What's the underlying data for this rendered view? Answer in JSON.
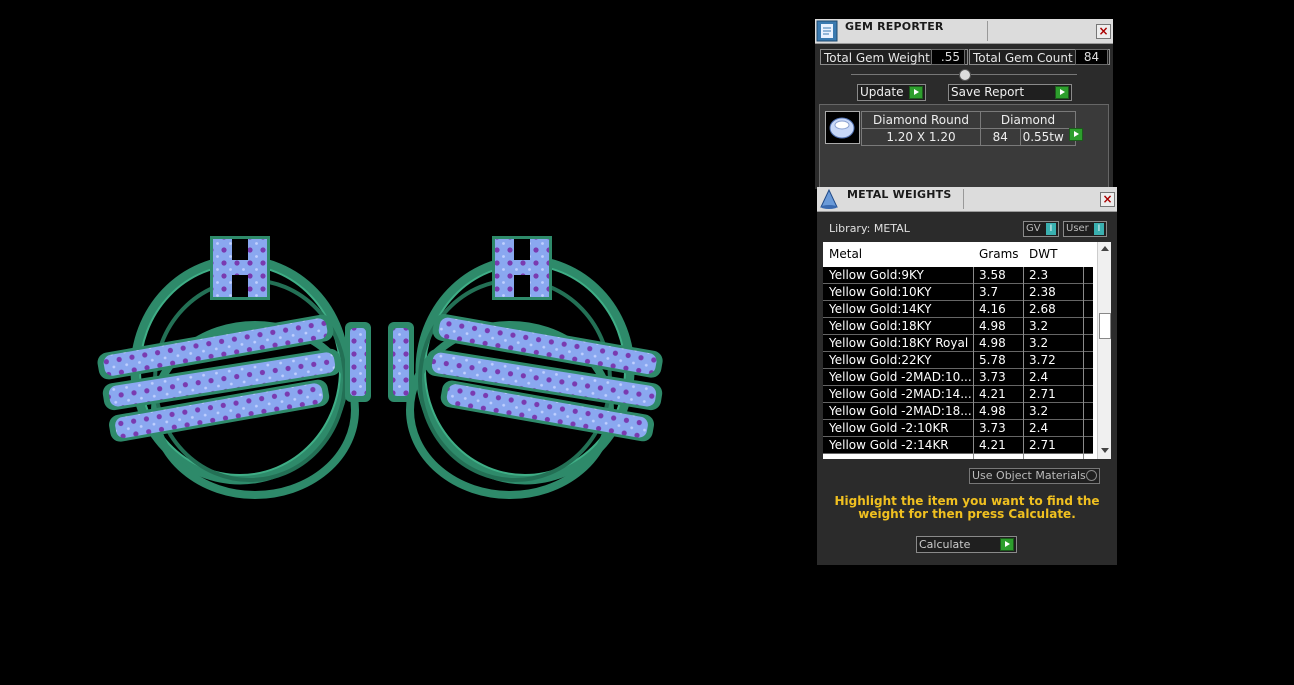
{
  "gem_reporter": {
    "title": "GEM REPORTER",
    "total_weight_label": "Total Gem Weight",
    "total_weight_value": ".55",
    "total_count_label": "Total Gem Count",
    "total_count_value": "84",
    "update_label": "Update",
    "save_report_label": "Save Report",
    "stone": {
      "icon": "round-diamond-icon",
      "shape": "Diamond Round",
      "material": "Diamond",
      "size": "1.20 X 1.20",
      "count": "84",
      "weight": "0.55tw"
    }
  },
  "metal_weights": {
    "title": "METAL WEIGHTS",
    "library_label": "Library: METAL",
    "gv_label": "GV",
    "user_label": "User",
    "columns": [
      "Metal",
      "Grams",
      "DWT"
    ],
    "rows": [
      {
        "metal": "Yellow Gold:9KY",
        "grams": "3.58",
        "dwt": "2.3"
      },
      {
        "metal": "Yellow Gold:10KY",
        "grams": "3.7",
        "dwt": "2.38"
      },
      {
        "metal": "Yellow Gold:14KY",
        "grams": "4.16",
        "dwt": "2.68"
      },
      {
        "metal": "Yellow Gold:18KY",
        "grams": "4.98",
        "dwt": "3.2"
      },
      {
        "metal": "Yellow Gold:18KY Royal",
        "grams": "4.98",
        "dwt": "3.2"
      },
      {
        "metal": "Yellow Gold:22KY",
        "grams": "5.78",
        "dwt": "3.72"
      },
      {
        "metal": "Yellow Gold -2MAD:10...",
        "grams": "3.73",
        "dwt": "2.4"
      },
      {
        "metal": "Yellow Gold -2MAD:14...",
        "grams": "4.21",
        "dwt": "2.71"
      },
      {
        "metal": "Yellow Gold -2MAD:18...",
        "grams": "4.98",
        "dwt": "3.2"
      },
      {
        "metal": "Yellow Gold -2:10KR",
        "grams": "3.73",
        "dwt": "2.4"
      },
      {
        "metal": "Yellow Gold -2:14KR",
        "grams": "4.21",
        "dwt": "2.71"
      }
    ],
    "use_object_materials_label": "Use Object Materials",
    "instruction": "Highlight the item you want to find the weight for then press Calculate.",
    "calculate_label": "Calculate"
  },
  "colors": {
    "metal_green": "#2e8a6a",
    "gem_blue": "#8aa8f0",
    "prong_purple": "#7a3ab0",
    "accent_yellow": "#f0c020",
    "button_green": "#2d9e2d"
  }
}
